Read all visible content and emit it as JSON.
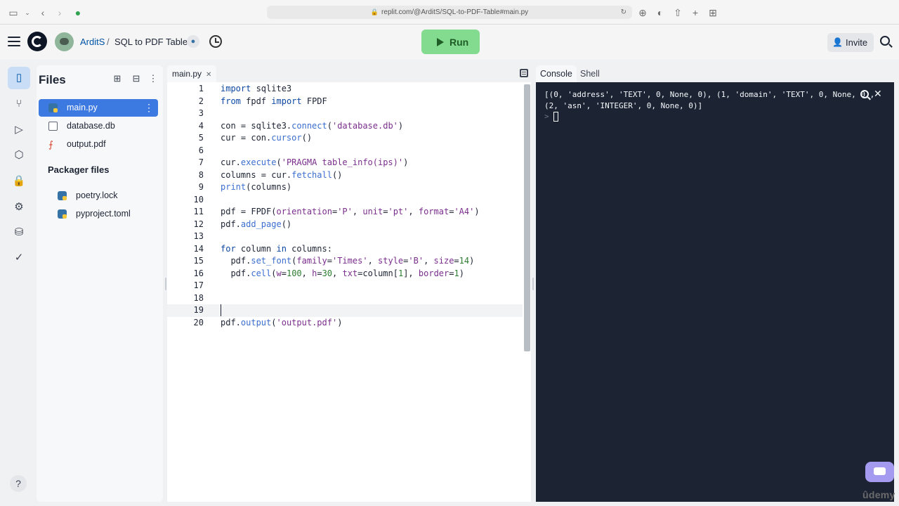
{
  "browser": {
    "url": "replit.com/@ArditS/SQL-to-PDF-Table#main.py"
  },
  "header": {
    "user": "ArditS",
    "separator": "/",
    "project": "SQL to PDF Table",
    "run_label": "Run",
    "invite_label": "Invite"
  },
  "files_panel": {
    "title": "Files",
    "files": [
      {
        "name": "main.py",
        "icon": "python-file-icon"
      },
      {
        "name": "database.db",
        "icon": "document-icon"
      },
      {
        "name": "output.pdf",
        "icon": "pdf-icon"
      }
    ],
    "packager_title": "Packager files",
    "packager_files": [
      {
        "name": "poetry.lock",
        "icon": "python-file-icon"
      },
      {
        "name": "pyproject.toml",
        "icon": "python-file-icon"
      }
    ]
  },
  "editor": {
    "tab": "main.py",
    "active_line": 19,
    "lines": [
      "import sqlite3",
      "from fpdf import FPDF",
      "",
      "con = sqlite3.connect('database.db')",
      "cur = con.cursor()",
      "",
      "cur.execute('PRAGMA table_info(ips)')",
      "columns = cur.fetchall()",
      "print(columns)",
      "",
      "pdf = FPDF(orientation='P', unit='pt', format='A4')",
      "pdf.add_page()",
      "",
      "for column in columns:",
      "  pdf.set_font(family='Times', style='B', size=14)",
      "  pdf.cell(w=100, h=30, txt=column[1], border=1)",
      "",
      "",
      "",
      "pdf.output('output.pdf')"
    ]
  },
  "console": {
    "tabs": [
      "Console",
      "Shell"
    ],
    "output": [
      "[(0, 'address', 'TEXT', 0, None, 0), (1, 'domain', 'TEXT', 0, None, 0),",
      "(2, 'asn', 'INTEGER', 0, None, 0)]"
    ],
    "prompt": ">"
  },
  "watermark": "ûdemy",
  "colors": {
    "run_button": "#82db8e",
    "selected_file": "#3c79e0",
    "console_bg": "#1c2333",
    "accent_link": "#0053a6"
  }
}
